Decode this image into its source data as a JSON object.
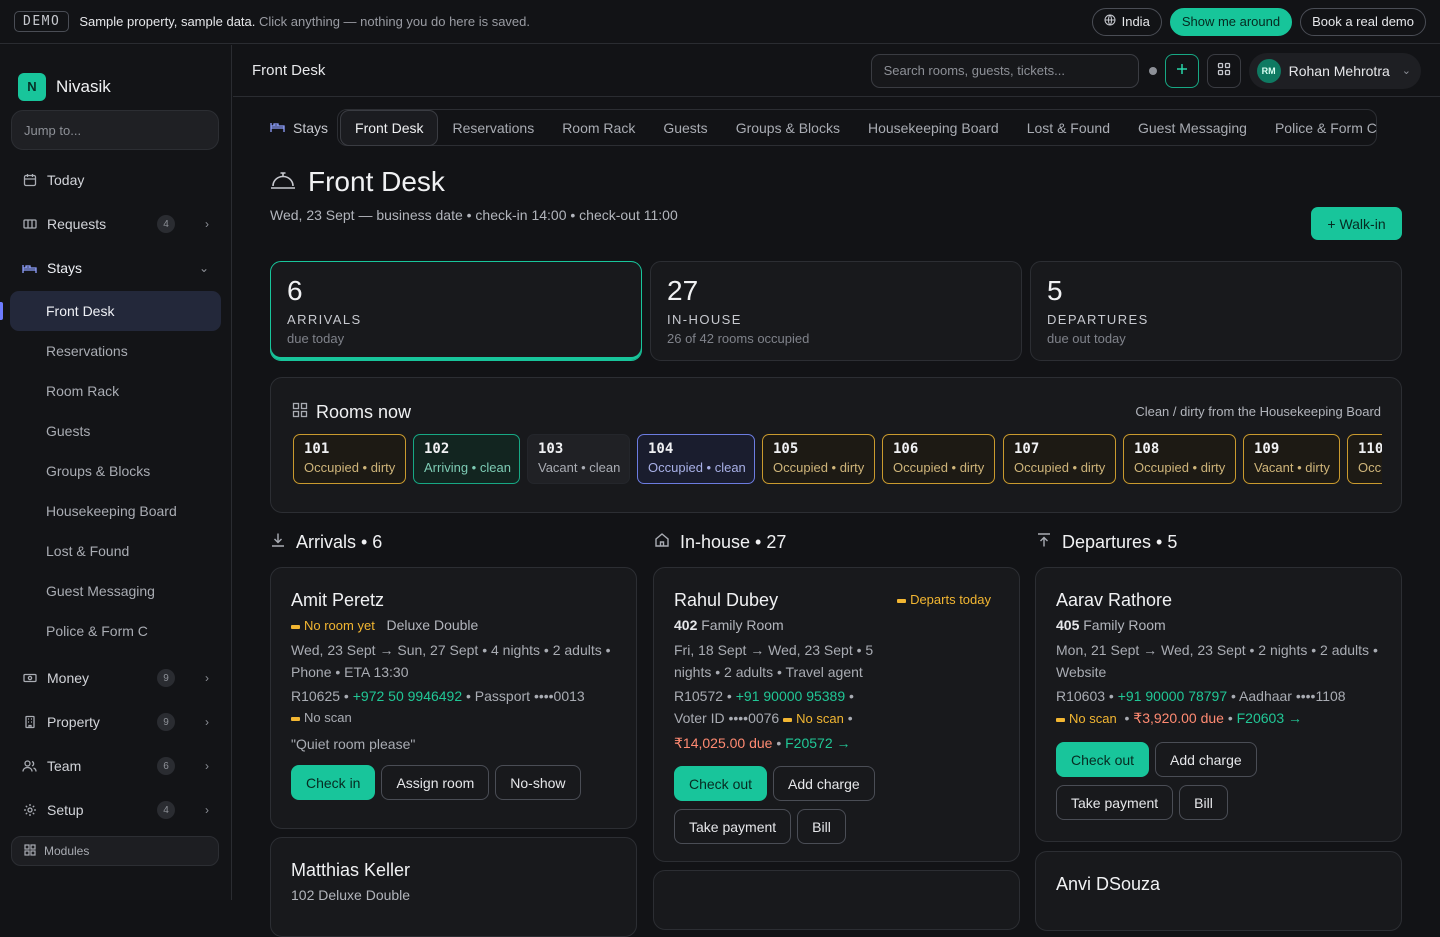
{
  "demo_bar": {
    "tag": "DEMO",
    "bold_text": "Sample property, sample data.",
    "text": "Click anything — nothing you do here is saved.",
    "region": "India",
    "show_around": "Show me around",
    "book_demo": "Book a real demo"
  },
  "sidebar": {
    "brand": "Nivasik",
    "brand_logo": "N",
    "jump_placeholder": "Jump to...",
    "items": [
      {
        "label": "Today",
        "icon": "calendar-icon"
      },
      {
        "label": "Requests",
        "icon": "ticket-icon",
        "badge": "4"
      },
      {
        "label": "Stays",
        "icon": "bed-icon"
      },
      {
        "label": "Money",
        "icon": "cash-icon",
        "badge": "9"
      },
      {
        "label": "Property",
        "icon": "building-icon",
        "badge": "9"
      },
      {
        "label": "Team",
        "icon": "people-icon",
        "badge": "6"
      },
      {
        "label": "Setup",
        "icon": "gear-icon",
        "badge": "4"
      }
    ],
    "stays_sub": [
      "Front Desk",
      "Reservations",
      "Room Rack",
      "Guests",
      "Groups & Blocks",
      "Housekeeping Board",
      "Lost & Found",
      "Guest Messaging",
      "Police & Form C"
    ],
    "modules": "Modules"
  },
  "topbar": {
    "title": "Front Desk",
    "search_placeholder": "Search rooms, guests, tickets...",
    "user_initials": "RM",
    "user_name": "Rohan Mehrotra"
  },
  "tabs": {
    "head": "Stays",
    "items": [
      "Front Desk",
      "Reservations",
      "Room Rack",
      "Guests",
      "Groups & Blocks",
      "Housekeeping Board",
      "Lost & Found",
      "Guest Messaging",
      "Police & Form C"
    ]
  },
  "page": {
    "title": "Front Desk",
    "subtitle": "Wed, 23 Sept — business date • check-in 14:00 • check-out 11:00",
    "walkin": "+ Walk-in"
  },
  "stats": [
    {
      "num": "6",
      "label": "ARRIVALS",
      "sub": "due today"
    },
    {
      "num": "27",
      "label": "IN-HOUSE",
      "sub": "26 of 42 rooms occupied"
    },
    {
      "num": "5",
      "label": "DEPARTURES",
      "sub": "due out today"
    }
  ],
  "rooms": {
    "title": "Rooms now",
    "note": "Clean / dirty from the Housekeeping Board",
    "list": [
      {
        "n": "101",
        "s": "Occupied • dirty"
      },
      {
        "n": "102",
        "s": "Arriving • clean"
      },
      {
        "n": "103",
        "s": "Vacant • clean"
      },
      {
        "n": "104",
        "s": "Occupied • clean"
      },
      {
        "n": "105",
        "s": "Occupied • dirty"
      },
      {
        "n": "106",
        "s": "Occupied • dirty"
      },
      {
        "n": "107",
        "s": "Occupied • dirty"
      },
      {
        "n": "108",
        "s": "Occupied • dirty"
      },
      {
        "n": "109",
        "s": "Vacant • dirty"
      },
      {
        "n": "110",
        "s": "Occupied • dirty"
      }
    ]
  },
  "columns": {
    "arrivals": "Arrivals • 6",
    "inhouse": "In-house • 27",
    "departures": "Departures • 5"
  },
  "arrival_card": {
    "name": "Amit Peretz",
    "no_room": "No room yet",
    "room_type": "Deluxe Double",
    "dates": "Wed, 23 Sept → Sun, 27 Sept • 4 nights • 2 adults •",
    "dates2": "Phone • ETA 13:30",
    "ref": "R10625 •",
    "phone": "+972 50 9946492",
    "id": "• Passport ••••0013",
    "no_scan": "No scan",
    "note": "\"Quiet room please\"",
    "btn1": "Check in",
    "btn2": "Assign room",
    "btn3": "No-show"
  },
  "arrival_card2": {
    "name": "Matthias Keller",
    "room": "102 Deluxe Double"
  },
  "inhouse_card": {
    "name": "Rahul Dubey",
    "tag": "Departs today",
    "room_no": "402",
    "room_type": "Family Room",
    "dates": "Fri, 18 Sept → Wed, 23 Sept • 5",
    "dates2": "nights • 2 adults • Travel agent",
    "ref": "R10572 •",
    "phone": "+91 90000 95389",
    "sep": "•",
    "id": "Voter ID ••••0076",
    "no_scan": "No scan",
    "due": "₹14,025.00 due",
    "folio": "F20572 →",
    "btn1": "Check out",
    "btn2": "Add charge",
    "btn3": "Take payment",
    "btn4": "Bill"
  },
  "departure_card": {
    "name": "Aarav Rathore",
    "room_no": "405",
    "room_type": "Family Room",
    "dates": "Mon, 21 Sept → Wed, 23 Sept • 2 nights • 2 adults •",
    "dates2": "Website",
    "ref": "R10603 •",
    "phone": "+91 90000 78797",
    "id": "• Aadhaar ••••1108",
    "no_scan": "No scan",
    "due": "₹3,920.00 due",
    "folio": "F20603 →",
    "btn1": "Check out",
    "btn2": "Add charge",
    "btn3": "Take payment",
    "btn4": "Bill"
  },
  "departure_card2": {
    "name": "Anvi DSouza"
  }
}
